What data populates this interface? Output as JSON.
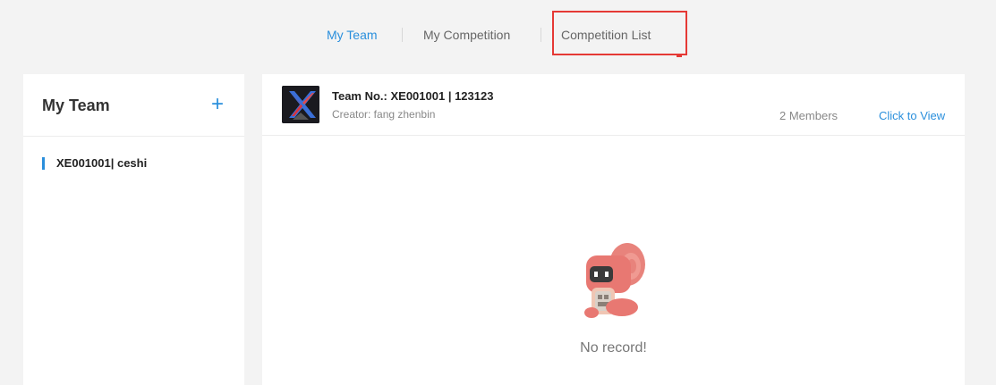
{
  "nav": {
    "tabs": [
      {
        "label": "My Team",
        "active": true
      },
      {
        "label": "My Competition",
        "active": false
      },
      {
        "label": "Competition List",
        "active": false
      }
    ]
  },
  "sidebar": {
    "title": "My Team",
    "add_icon": "+",
    "items": [
      {
        "label": "XE001001| ceshi"
      }
    ]
  },
  "team_card": {
    "team_no": "Team No.: XE001001 | 123123",
    "creator": "Creator: fang zhenbin",
    "members": "2 Members",
    "view_link": "Click to View",
    "avatar_icon": "team-logo-x"
  },
  "empty_state": {
    "text": "No record!",
    "illustration": "robot-mascot-illustration"
  },
  "colors": {
    "accent": "#2a8fdc",
    "highlight": "#e53935",
    "mascot": "#e87872"
  }
}
